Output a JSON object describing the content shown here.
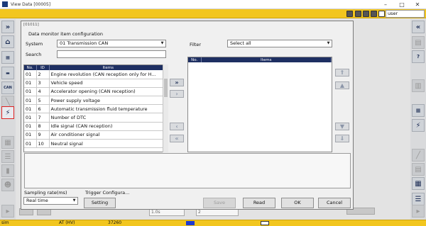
{
  "window": {
    "title": "View Data [00005]"
  },
  "toolbar": {
    "user": "user"
  },
  "dialog": {
    "code": "[01011]",
    "title": "Data monitor item configuration",
    "system_label": "System",
    "system_value": "01  Transmission  CAN",
    "search_label": "Search",
    "search_value": "",
    "filter_label": "Filter",
    "filter_value": "Select all",
    "left_table": {
      "columns": [
        "No.",
        "ID",
        "Items"
      ],
      "rows": [
        [
          "01",
          "2",
          "Engine revolution (CAN reception only for H..."
        ],
        [
          "01",
          "3",
          "Vehicle speed"
        ],
        [
          "01",
          "4",
          "Accelerator opening (CAN reception)"
        ],
        [
          "01",
          "5",
          "Power supply voltage"
        ],
        [
          "01",
          "6",
          "Automatic transmission fluid temperature"
        ],
        [
          "01",
          "7",
          "Number of DTC"
        ],
        [
          "01",
          "8",
          "Idle signal (CAN reception)"
        ],
        [
          "01",
          "9",
          "Air conditioner signal"
        ],
        [
          "01",
          "10",
          "Neutral signal"
        ]
      ]
    },
    "right_table": {
      "columns": [
        "No.",
        "Items"
      ],
      "rows": []
    },
    "sampling_label": "Sampling rate(ms)",
    "sampling_value": "Real time",
    "trigger_label": "Trigger Configura...",
    "setting_button": "Setting",
    "save_button": "Save",
    "read_button": "Read",
    "ok_button": "OK",
    "cancel_button": "Cancel"
  },
  "background": {
    "dropdown_a": "1.0s",
    "dropdown_b": "2"
  },
  "statusbar": {
    "mode": "sim",
    "vehicle": "AT (HV)",
    "value": "37260"
  },
  "colors": {
    "accent_yellow": "#f2c61f",
    "table_header": "#1e2f62",
    "icon_navy": "#1d2d55"
  }
}
